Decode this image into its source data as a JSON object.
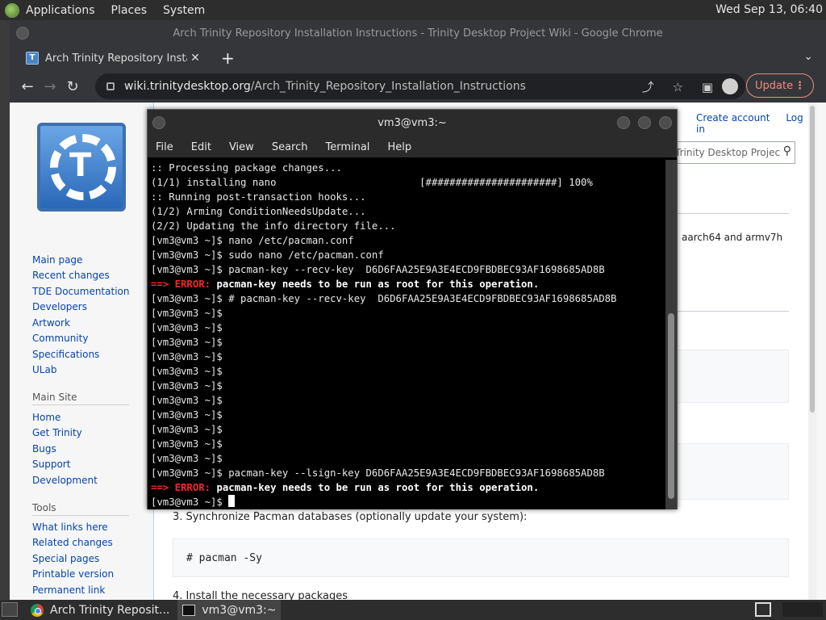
{
  "top_panel": {
    "menus": [
      "Applications",
      "Places",
      "System"
    ],
    "clock": "Wed Sep 13, 06:40"
  },
  "chrome": {
    "window_title": "Arch Trinity Repository Installation Instructions - Trinity Desktop Project Wiki - Google Chrome",
    "tab_title": "Arch Trinity Repository Installa",
    "url_host": "wiki.trinitydesktop.org",
    "url_path": "/Arch_Trinity_Repository_Installation_Instructions",
    "update_label": "Update"
  },
  "wiki": {
    "account": [
      "Create account",
      "Log in"
    ],
    "search_placeholder": "Trinity Desktop Projec",
    "nav_main": [
      "Main page",
      "Recent changes",
      "TDE Documentation",
      "Developers",
      "Artwork",
      "Community",
      "Specifications",
      "ULab"
    ],
    "section_main_site": "Main Site",
    "nav_site": [
      "Home",
      "Get Trinity",
      "Bugs",
      "Support",
      "Development"
    ],
    "section_tools": "Tools",
    "nav_tools": [
      "What links here",
      "Related changes",
      "Special pages",
      "Printable version",
      "Permanent link"
    ],
    "partial_text": "aarch64 and armv7h",
    "step3": "3. Synchronize Pacman databases (optionally update your system):",
    "step3_code": "# pacman -Sy",
    "step4": "4. Install the necessary packages"
  },
  "terminal": {
    "title": "vm3@vm3:~",
    "menus": [
      "File",
      "Edit",
      "View",
      "Search",
      "Terminal",
      "Help"
    ],
    "lines": [
      ":: Processing package changes...",
      "(1/1) installing nano                        [######################] 100%",
      ":: Running post-transaction hooks...",
      "(1/2) Arming ConditionNeedsUpdate...",
      "(2/2) Updating the info directory file...",
      "[vm3@vm3 ~]$ nano /etc/pacman.conf",
      "[vm3@vm3 ~]$ sudo nano /etc/pacman.conf",
      "[vm3@vm3 ~]$ pacman-key --recv-key  D6D6FAA25E9A3E4ECD9FBDBEC93AF1698685AD8B"
    ],
    "error_arrow": "==> ERROR:",
    "error_msg": "pacman-key needs to be run as root for this operation.",
    "lines2": [
      "[vm3@vm3 ~]$ # pacman-key --recv-key  D6D6FAA25E9A3E4ECD9FBDBEC93AF1698685AD8B",
      "[vm3@vm3 ~]$",
      "[vm3@vm3 ~]$",
      "[vm3@vm3 ~]$",
      "[vm3@vm3 ~]$",
      "[vm3@vm3 ~]$",
      "[vm3@vm3 ~]$",
      "[vm3@vm3 ~]$",
      "[vm3@vm3 ~]$",
      "[vm3@vm3 ~]$",
      "[vm3@vm3 ~]$",
      "[vm3@vm3 ~]$",
      "[vm3@vm3 ~]$ pacman-key --lsign-key D6D6FAA25E9A3E4ECD9FBDBEC93AF1698685AD8B"
    ],
    "prompt": "[vm3@vm3 ~]$ "
  },
  "taskbar": {
    "items": [
      "Arch Trinity Reposit...",
      "vm3@vm3:~"
    ]
  }
}
